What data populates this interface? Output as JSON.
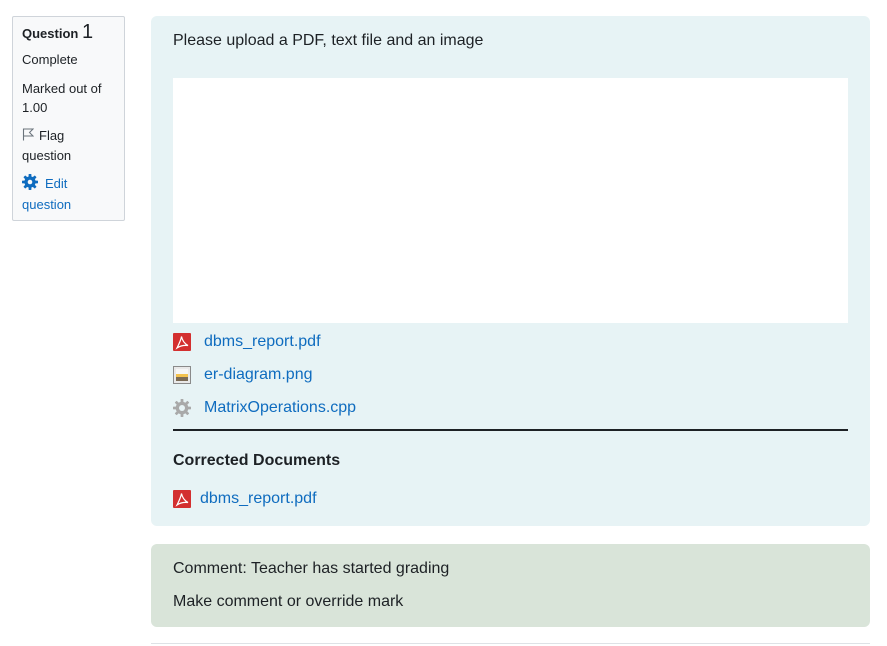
{
  "info": {
    "question_word": "Question",
    "question_number": "1",
    "state": "Complete",
    "grade": "Marked out of 1.00",
    "flag_label": "Flag question",
    "edit_label": "Edit question"
  },
  "formulation": {
    "question_text": "Please upload a PDF, text file and an image",
    "files": [
      {
        "name": "dbms_report.pdf",
        "icon": "pdf-icon"
      },
      {
        "name": "er-diagram.png",
        "icon": "image-icon"
      },
      {
        "name": "MatrixOperations.cpp",
        "icon": "gear-file-icon"
      }
    ],
    "corrected_heading": "Corrected Documents",
    "corrected_files": [
      {
        "name": "dbms_report.pdf",
        "icon": "pdf-icon"
      }
    ]
  },
  "comment": {
    "status": "Comment: Teacher has started grading",
    "action": "Make comment or override mark"
  },
  "colors": {
    "link": "#0f6cbf",
    "formulation_bg": "#e7f3f5",
    "comment_bg": "#d9e4d9",
    "pdf_red": "#d32f2f"
  }
}
